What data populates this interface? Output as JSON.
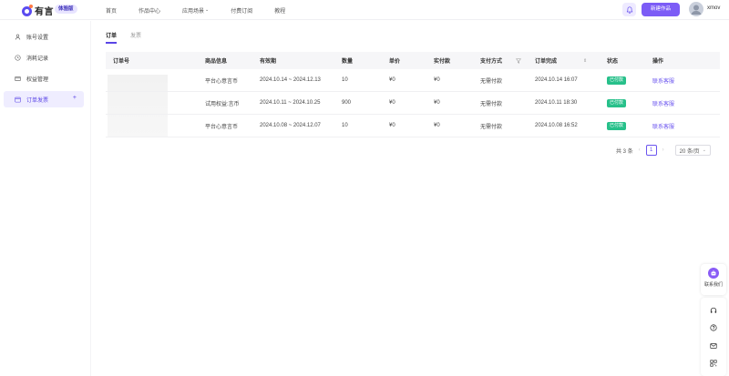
{
  "header": {
    "logo_text": "有言",
    "edition_badge": "体验版",
    "nav": [
      {
        "label": "首页"
      },
      {
        "label": "作品中心"
      },
      {
        "label": "应用场景"
      },
      {
        "label": "付费订阅"
      },
      {
        "label": "教程"
      }
    ],
    "new_button": "新建作品",
    "username": "xmov"
  },
  "sidebar": {
    "items": [
      {
        "label": "账号设置",
        "icon": "user-icon"
      },
      {
        "label": "消耗记录",
        "icon": "clock-icon"
      },
      {
        "label": "权益管理",
        "icon": "card-icon"
      },
      {
        "label": "订单发票",
        "icon": "calendar-icon",
        "active": true
      }
    ]
  },
  "tabs": [
    {
      "label": "订单",
      "active": true
    },
    {
      "label": "发票",
      "active": false
    }
  ],
  "table": {
    "columns": [
      "订单号",
      "商品信息",
      "有效期",
      "数量",
      "单价",
      "实付款",
      "支付方式",
      "订单完成",
      "状态",
      "操作"
    ],
    "rows": [
      {
        "id": "",
        "info": "平台心意言币",
        "valid": "2024.10.14 ~ 2024.12.13",
        "qty": "10",
        "price": "¥0",
        "paid": "¥0",
        "method": "无需付款",
        "done": "2024.10.14 16:07",
        "status": "已付款",
        "op": "联系客服"
      },
      {
        "id": "",
        "info": "试用权益:言币",
        "valid": "2024.10.11 ~ 2024.10.25",
        "qty": "900",
        "price": "¥0",
        "paid": "¥0",
        "method": "无需付款",
        "done": "2024.10.11 18:30",
        "status": "已付款",
        "op": "联系客服"
      },
      {
        "id": "",
        "info": "平台心意言币",
        "valid": "2024.10.08 ~ 2024.12.07",
        "qty": "10",
        "price": "¥0",
        "paid": "¥0",
        "method": "无需付款",
        "done": "2024.10.08 16:52",
        "status": "已付款",
        "op": "联系客服"
      }
    ]
  },
  "pagination": {
    "total": "共 3 条",
    "page": "1",
    "page_size": "20 条/页"
  },
  "float": {
    "service_label": "联系我们"
  },
  "colors": {
    "accent": "#7c5cf6",
    "status_green": "#27c08a"
  }
}
